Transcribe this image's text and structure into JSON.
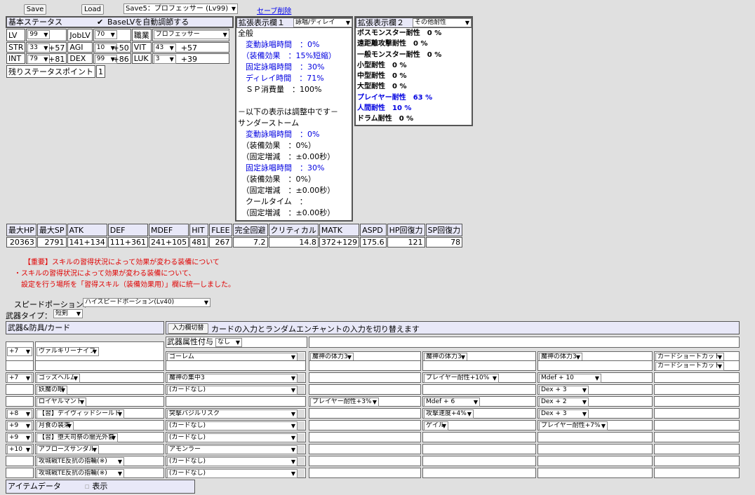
{
  "toolbar": {
    "save": "Save",
    "load": "Load",
    "slot": "Save5：プロフェッサー (Lv99)",
    "delete_link": "セーブ削除"
  },
  "basic": {
    "title": "基本ステータス",
    "auto_label": "BaseLVを自動調節する",
    "lv_label": "LV",
    "lv": "99",
    "joblv_label": "JobLV",
    "joblv": "70",
    "job_label": "職業",
    "job": "プロフェッサー",
    "str_label": "STR",
    "str": "33",
    "str_bonus": "+57",
    "agi_label": "AGI",
    "agi": "10",
    "agi_bonus": "+50",
    "vit_label": "VIT",
    "vit": "43",
    "vit_bonus": "+57",
    "int_label": "INT",
    "int": "79",
    "int_bonus": "+81",
    "dex_label": "DEX",
    "dex": "99",
    "dex_bonus": "+86",
    "luk_label": "LUK",
    "luk": "3",
    "luk_bonus": "+39",
    "points_label": "残りステータスポイント",
    "points": "1"
  },
  "ext1": {
    "title": "拡張表示欄１",
    "select": "詠唱/ディレイ",
    "lines": [
      {
        "t": "全般",
        "c": ""
      },
      {
        "t": "　変動詠唱時間　：0%",
        "c": "blue"
      },
      {
        "t": "　（装備効果　：15%短縮）",
        "c": "blue"
      },
      {
        "t": "　固定詠唱時間　：30%",
        "c": "blue"
      },
      {
        "t": "　ディレイ時間　：71%",
        "c": "blue"
      },
      {
        "t": "　ＳＰ消費量　：100%",
        "c": ""
      },
      {
        "t": "",
        "c": ""
      },
      {
        "t": "－以下の表示は調整中です－",
        "c": ""
      },
      {
        "t": "サンダーストーム",
        "c": ""
      },
      {
        "t": "　変動詠唱時間　：0%",
        "c": "blue"
      },
      {
        "t": "　（装備効果　：0%）",
        "c": ""
      },
      {
        "t": "　（固定増減　：±0.00秒）",
        "c": ""
      },
      {
        "t": "　固定詠唱時間　：30%",
        "c": "blue"
      },
      {
        "t": "　（装備効果　：0%）",
        "c": ""
      },
      {
        "t": "　（固定増減　：±0.00秒）",
        "c": ""
      },
      {
        "t": "　クールタイム　：",
        "c": ""
      },
      {
        "t": "　（固定増減　：±0.00秒）",
        "c": ""
      }
    ]
  },
  "ext2": {
    "title": "拡張表示欄２",
    "select": "その他耐性",
    "lines": [
      {
        "t": "ボスモンスター耐性　0 %",
        "c": ""
      },
      {
        "t": "遠距離攻撃耐性　0 %",
        "c": ""
      },
      {
        "t": "一般モンスター耐性　0 %",
        "c": ""
      },
      {
        "t": "小型耐性　0 %",
        "c": ""
      },
      {
        "t": "中型耐性　0 %",
        "c": ""
      },
      {
        "t": "大型耐性　0 %",
        "c": ""
      },
      {
        "t": "プレイヤー耐性　63 %",
        "c": "blue"
      },
      {
        "t": "人間耐性　10 %",
        "c": "blue"
      },
      {
        "t": "ドラム耐性　0 %",
        "c": ""
      }
    ]
  },
  "stats": {
    "headers": [
      "最大HP",
      "最大SP",
      "ATK",
      "DEF",
      "MDEF",
      "HIT",
      "FLEE",
      "完全回避",
      "クリティカル",
      "MATK",
      "ASPD",
      "HP回復力",
      "SP回復力"
    ],
    "values": [
      "20363",
      "2791",
      "141+134",
      "111+361",
      "241+105",
      "481",
      "267",
      "7.2",
      "14.8",
      "372+129",
      "175.6",
      "121",
      "78"
    ]
  },
  "notice": {
    "line1": "【重要】スキルの習得状況によって効果が変わる装備について",
    "line2": "・スキルの習得状況によって効果が変わる装備について、",
    "line3": "　設定を行う場所を「習得スキル（装備効果用）」欄に統一しました。"
  },
  "speed": {
    "label": "スピードポーション：",
    "value": "ハイスピードポーション(Lv40)"
  },
  "weapon_type": {
    "label": "武器タイプ：",
    "value": "短剣"
  },
  "equip": {
    "title": "武器&防具/カード",
    "toggle": "入力欄切替",
    "toggle_desc": "カードの入力とランダムエンチャントの入力を切り替えます",
    "element_label": "武器属性付与",
    "element": "なし",
    "rows": [
      {
        "refine": "+7",
        "item": "ヴァルキリーナイフ",
        "c1": "ゴーレム",
        "c2": "魔神の体力3",
        "c3": "魔神の体力3",
        "c4": "魔神の体力3",
        "c5": "カードショートカット"
      },
      {
        "refine": "",
        "item": "",
        "c1": "",
        "c2": "",
        "c3": "",
        "c4": "",
        "c5": "カードショートカット"
      },
      {
        "refine": "+7",
        "item": "ゴッズヘルム",
        "c1": "魔神の集中3",
        "c2": "",
        "c3": "プレイヤー耐性+10%",
        "c4": "Mdef + 10",
        "c5": ""
      },
      {
        "refine": "",
        "item": "妖魔の眼",
        "c1": "(カードなし)",
        "c2": "",
        "c3": "",
        "c4": "Dex + 3",
        "c5": ""
      },
      {
        "refine": "",
        "item": "ロイヤルマント",
        "c1": "",
        "c2": "プレイヤー耐性+3%",
        "c3": "Mdef + 6",
        "c4": "Dex + 2",
        "c5": ""
      },
      {
        "refine": "+8",
        "item": "【習】デイヴィッドシールド",
        "c1": "突撃バジルリスク",
        "c2": "",
        "c3": "攻撃速度+4%",
        "c4": "Dex + 3",
        "c5": ""
      },
      {
        "refine": "+9",
        "item": "月食の装束",
        "c1": "(カードなし)",
        "c2": "",
        "c3": "ゲイル",
        "c4": "プレイヤー耐性+7%",
        "c5": ""
      },
      {
        "refine": "+9",
        "item": "【習】堕天司祭の闇光外套",
        "c1": "(カードなし)",
        "c2": "",
        "c3": "",
        "c4": "",
        "c5": ""
      },
      {
        "refine": "+10",
        "item": "アブローズサンダル",
        "c1": "アモンラー",
        "c2": "",
        "c3": "",
        "c4": "",
        "c5": ""
      },
      {
        "refine": "",
        "item": "攻城戦TE反抗の指輪(※)",
        "c1": "(カードなし)",
        "c2": "",
        "c3": "",
        "c4": "",
        "c5": ""
      },
      {
        "refine": "",
        "item": "攻城戦TE反抗の指輪(※)",
        "c1": "(カードなし)",
        "c2": "",
        "c3": "",
        "c4": "",
        "c5": ""
      }
    ]
  },
  "itemdata": {
    "title": "アイテムデータ",
    "show": "表示"
  }
}
